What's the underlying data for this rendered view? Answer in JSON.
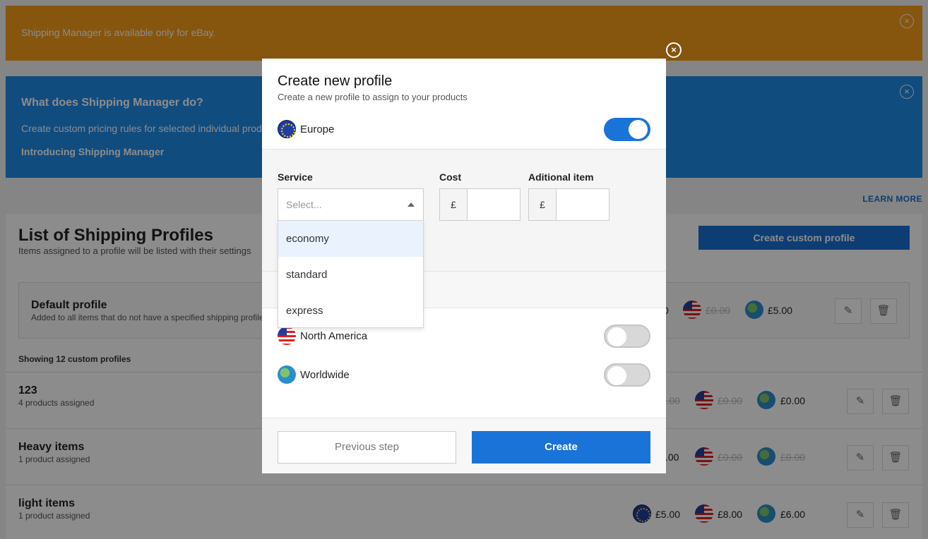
{
  "banners": {
    "warning": {
      "text": "Shipping Manager is available only for eBay.",
      "close_icon": "×"
    },
    "info": {
      "title": "What does Shipping Manager do?",
      "text": "Create custom pricing rules for selected individual products.",
      "link": "Introducing Shipping Manager",
      "close_icon": "×"
    }
  },
  "learn_more": "LEARN MORE",
  "list": {
    "title": "List of Shipping Profiles",
    "subtitle": "Items assigned to a profile will be listed with their settings",
    "create_button": "Create custom profile",
    "default_profile": {
      "name": "Default profile",
      "desc": "Added to all items that do not have a specified shipping profile",
      "europe_price": "0",
      "na_price": "£0.00",
      "ww_price": "£5.00"
    },
    "showing": "Showing 12 custom profiles",
    "profiles": [
      {
        "name": "123",
        "assigned": "4 products assigned",
        "europe_price": "£0.00",
        "na_price": "£0.00",
        "ww_price": "£0.00"
      },
      {
        "name": "Heavy items",
        "assigned": "1 product assigned",
        "europe_price": ".00",
        "na_price": "£0.00",
        "ww_price": "£0.00"
      },
      {
        "name": "light items",
        "assigned": "1 product assigned",
        "europe_price": "£5.00",
        "na_price": "£8.00",
        "ww_price": "£6.00"
      }
    ],
    "edit_icon": "✎",
    "delete_icon": "🗑"
  },
  "modal": {
    "close_icon": "×",
    "title": "Create new profile",
    "subtitle": "Create a new profile to assign to your products",
    "regions": [
      {
        "label": "Europe",
        "enabled": true
      },
      {
        "label": "North America",
        "enabled": false
      },
      {
        "label": "Worldwide",
        "enabled": false
      }
    ],
    "service_label": "Service",
    "service_placeholder": "Select...",
    "service_options": [
      "economy",
      "standard",
      "express"
    ],
    "cost_label": "Cost",
    "additional_label": "Aditional item",
    "currency_symbol": "£",
    "previous_button": "Previous step",
    "create_button": "Create"
  },
  "colors": {
    "accent": "#1a73d9",
    "warning": "#f59c1a",
    "info": "#1f8ae8"
  }
}
